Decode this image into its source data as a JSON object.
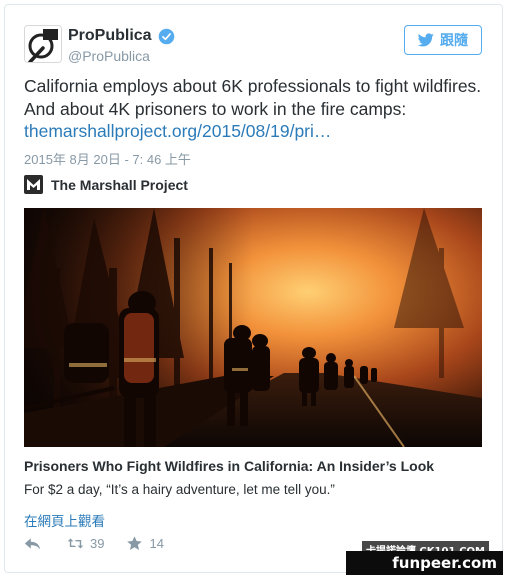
{
  "user": {
    "display_name": "ProPublica",
    "handle": "@ProPublica",
    "verified_icon": "verified-badge-icon"
  },
  "follow_button": {
    "label": "跟隨",
    "icon": "twitter-bird-icon"
  },
  "tweet": {
    "text": "California employs about 6K professionals to fight wildfires. And about 4K prisoners to work in the fire camps:",
    "link_text": "themarshallproject.org/2015/08/19/pri…",
    "timestamp": "2015年 8月 20日 - 7: 46 上午"
  },
  "card": {
    "source_name": "The Marshall Project",
    "title": "Prisoners Who Fight Wildfires in California: An Insider’s Look",
    "description": "For $2 a day, “It’s a hairy adventure, let me tell you.”",
    "view_link": "在網頁上觀看"
  },
  "actions": {
    "reply_icon": "reply-icon",
    "retweet_count": "39",
    "favorite_count": "14"
  },
  "watermark": {
    "main": "funpeer.com",
    "small": "卡提諾論壇 CK101.COM"
  },
  "colors": {
    "accent": "#55acee",
    "link": "#2b7bb9",
    "muted": "#8899a6",
    "text": "#292f33"
  }
}
